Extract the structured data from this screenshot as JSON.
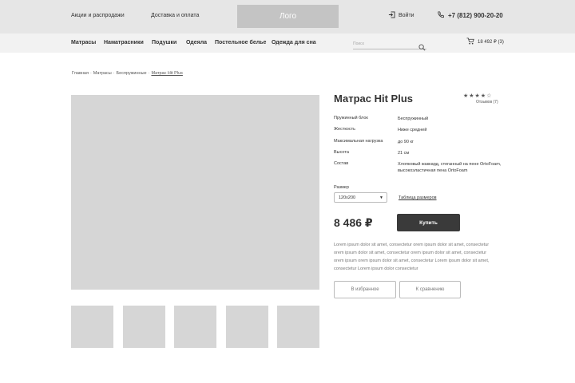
{
  "topbar": {
    "promo_link": "Акции и распродажи",
    "delivery_link": "Доставка и оплата",
    "logo": "Лого",
    "login": "Войти",
    "phone": "+7 (812) 900-20-20"
  },
  "nav": {
    "items": [
      "Матрасы",
      "Наматрасники",
      "Подушки",
      "Одеяла",
      "Постельное белье",
      "Одежда для сна"
    ],
    "search_placeholder": "Поиск",
    "cart": "18 492 ₽  (3)"
  },
  "breadcrumb": [
    "Главная",
    "Матрасы",
    "Беспружинные",
    "Матрас Hit Plus"
  ],
  "product": {
    "title": "Матрас Hit Plus",
    "stars": "★★★★☆",
    "rating": 4,
    "reviews": "Отзывов (7)",
    "specs": [
      {
        "key": "Пружинный блок",
        "value": "Беспружинный"
      },
      {
        "key": "Жесткость",
        "value": "Ниже средней"
      },
      {
        "key": "Максимальная нагрузка",
        "value": "до 90 кг"
      },
      {
        "key": "Высота",
        "value": "21 см"
      },
      {
        "key": "Состав",
        "value": "Хлопковый жаккард, стеганный на пене OrtoFoam, высокоэластичная пена OrtoFoam"
      }
    ],
    "size_label": "Размер",
    "size_value": "120x200",
    "size_table": "Таблица размеров",
    "price": "8 486 ₽",
    "buy": "Купить",
    "description": "Lorem ipsum dolor sit amet, consectetur orem ipsum dolor sit amet, consectetur orem ipsum dolor sit amet, consectetur orem ipsum dolor sit amet, consectetur orem ipsum orem ipsum dolor sit amet, consectetur Lorem ipsum dolor sit amet, consectetur Lorem ipsum dolor consectetur",
    "favorites": "В избранное",
    "compare": "К сравнению"
  },
  "colors": {
    "topbar": "#e6e6e6",
    "navbar": "#f2f2f2",
    "placeholder": "#d6d6d6",
    "button": "#3a3a3a"
  }
}
